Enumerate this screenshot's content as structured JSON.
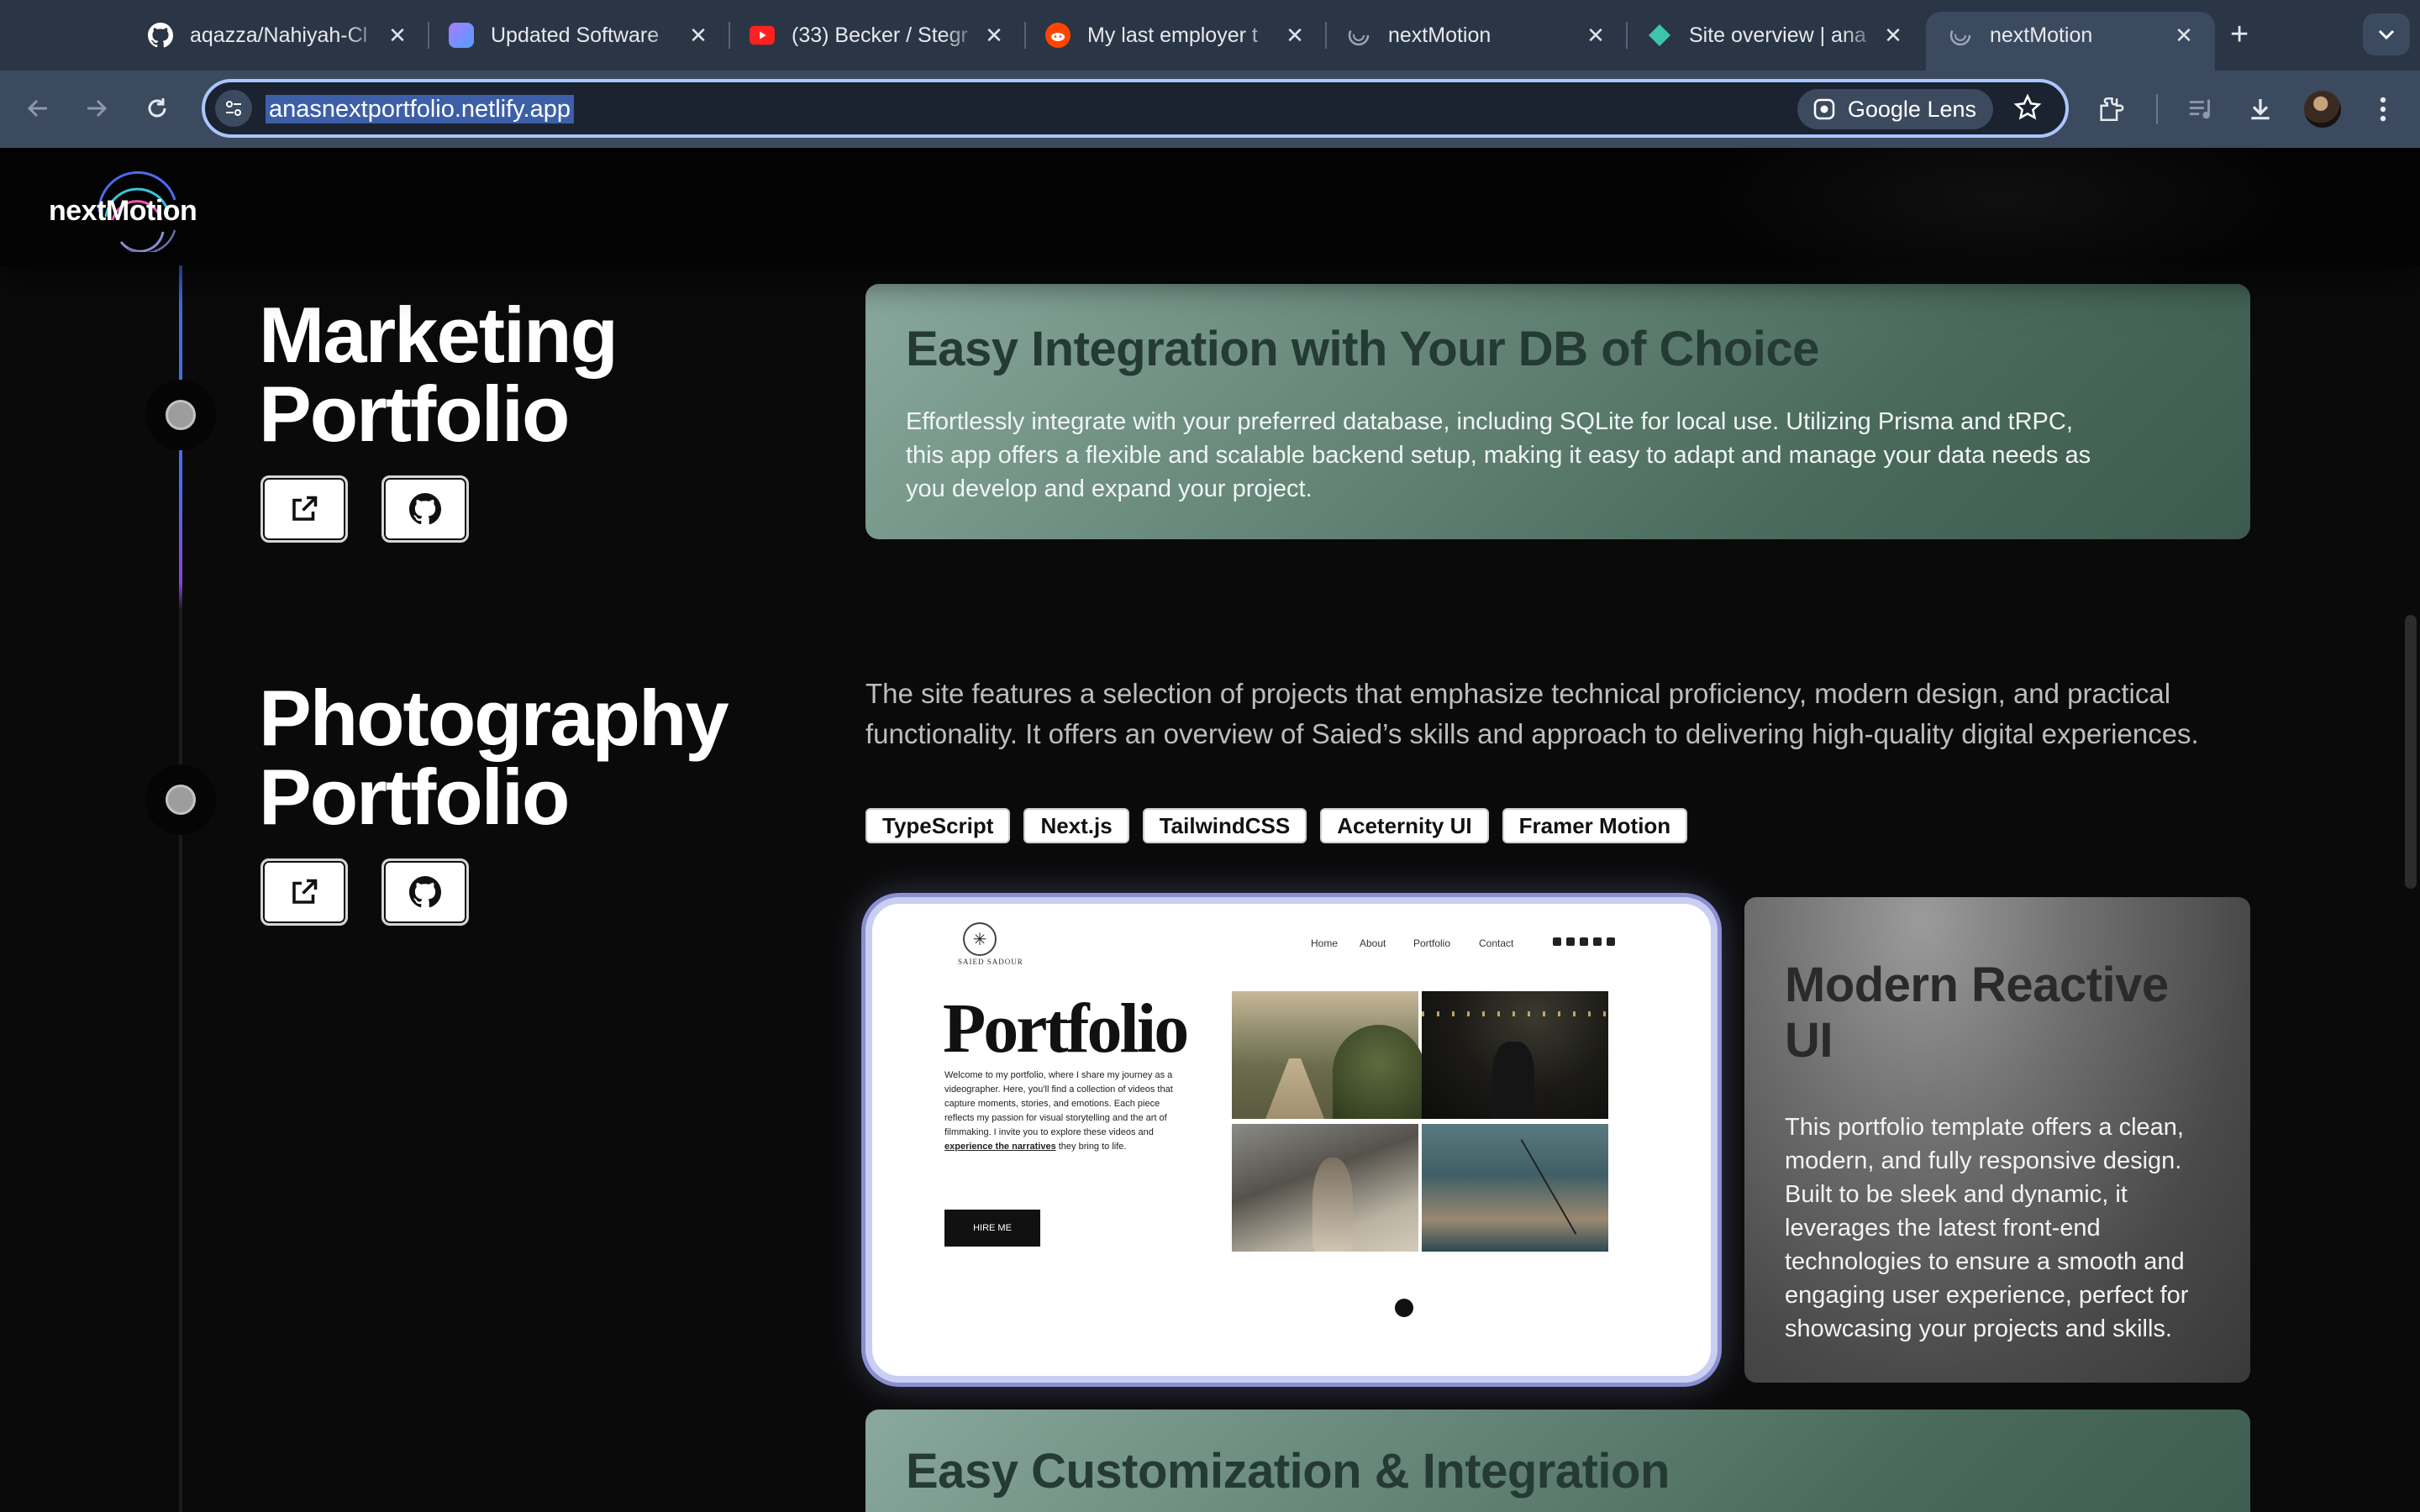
{
  "browser": {
    "tabs": [
      {
        "title": "aqazza/Nahiyah-Cl",
        "favicon": "github-icon",
        "color": "#ffffff"
      },
      {
        "title": "Updated Software",
        "favicon": "app-icon",
        "color": "#7b7bff"
      },
      {
        "title": "(33) Becker / Stegr",
        "favicon": "youtube-icon",
        "color": "#ff2b2b"
      },
      {
        "title": "My last employer t",
        "favicon": "reddit-icon",
        "color": "#ff4500"
      },
      {
        "title": "nextMotion",
        "favicon": "nextmotion-icon",
        "color": "#9aa5b8"
      },
      {
        "title": "Site overview | ana",
        "favicon": "netlify-icon",
        "color": "#3ec3b0"
      },
      {
        "title": "nextMotion",
        "favicon": "nextmotion-icon",
        "color": "#9aa5b8"
      }
    ],
    "url": "anasnextportfolio.netlify.app",
    "lens_label": "Google Lens"
  },
  "site": {
    "logo": "nextMotion"
  },
  "projects": [
    {
      "title_line1": "Marketing",
      "title_line2": "Portfolio",
      "feature": {
        "heading": "Easy Integration with Your DB of Choice",
        "body": "Effortlessly integrate with your preferred database, including SQLite for local use. Utilizing Prisma and tRPC, this app offers a flexible and scalable backend setup, making it easy to adapt and manage your data needs as you develop and expand your project."
      }
    },
    {
      "title_line1": "Photography",
      "title_line2": "Portfolio",
      "description": "The site features a selection of projects that emphasize technical proficiency, modern design, and practical functionality. It offers an overview of Saied’s skills and approach to delivering high-quality digital experiences.",
      "tags": [
        "TypeScript",
        "Next.js",
        "TailwindCSS",
        "Aceternity UI",
        "Framer Motion"
      ],
      "preview": {
        "logo_text": "SAIED SADOUR",
        "nav": [
          "Home",
          "About",
          "Portfolio",
          "Contact"
        ],
        "title": "Portfolio",
        "body_pre": "Welcome to my portfolio, where I share my journey as a videographer. Here, you'll find a collection of videos that capture moments, stories, and emotions. Each piece reflects my passion for visual storytelling and the art of filmmaking. I invite you to explore these videos and ",
        "body_link": "experience the narratives",
        "body_post": " they bring to life.",
        "cta": "HIRE ME"
      },
      "card": {
        "heading": "Modern Reactive UI",
        "body": "This portfolio template offers a clean, modern, and fully responsive design. Built to be sleek and dynamic, it leverages the latest front-end technologies to ensure a smooth and engaging user experience, perfect for showcasing your projects and skills."
      }
    }
  ],
  "next_feature": {
    "heading": "Easy Customization & Integration"
  }
}
